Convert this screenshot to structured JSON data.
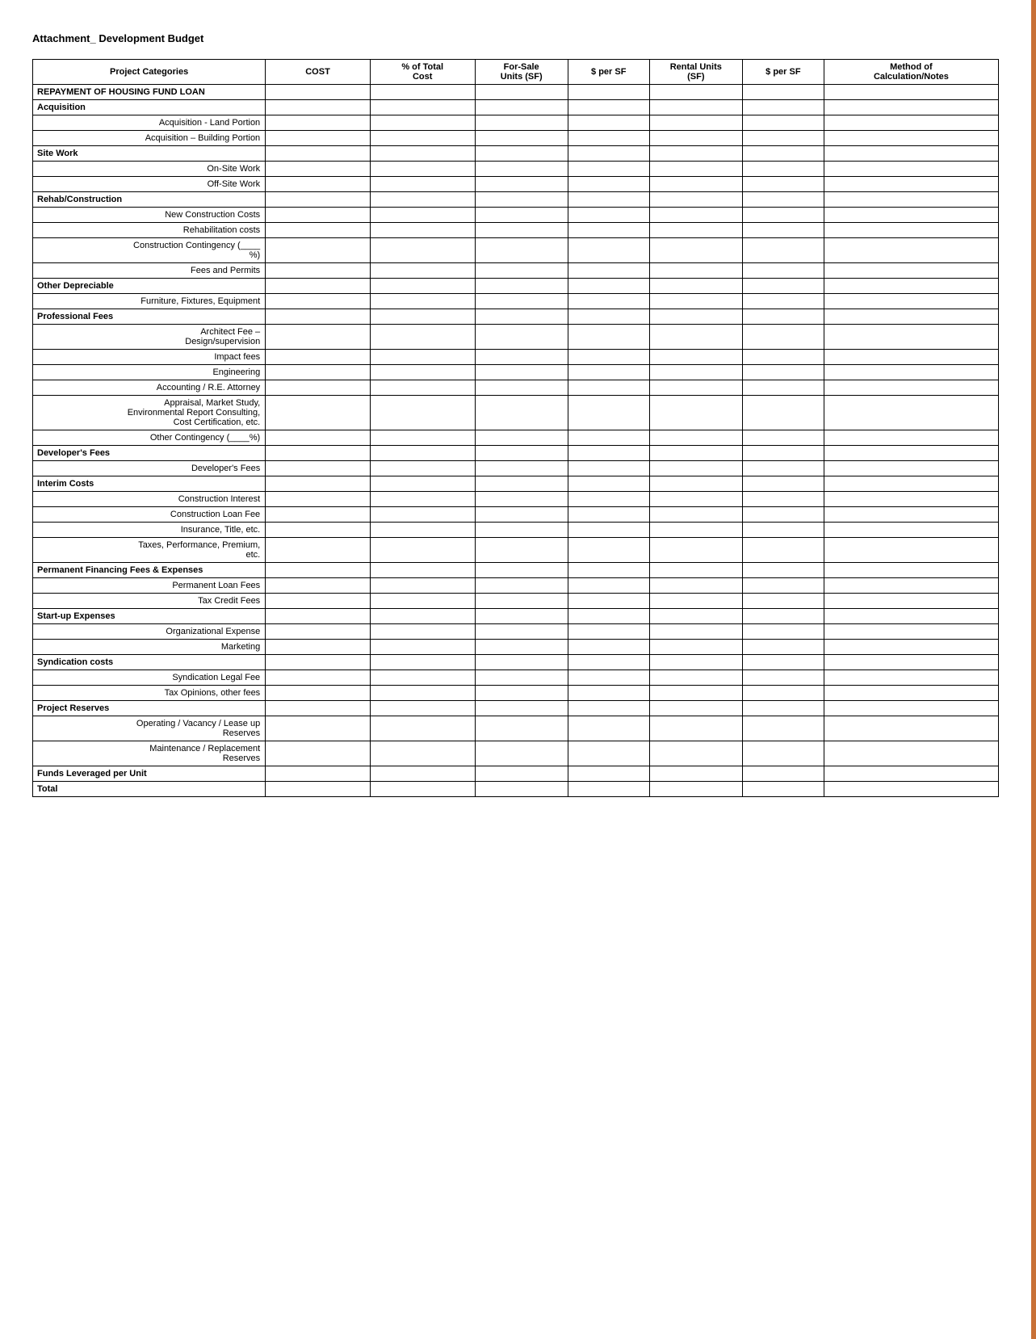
{
  "title": "Attachment_ Development Budget",
  "columns": {
    "project_categories": "Project Categories",
    "cost": "COST",
    "pct_total_cost": "% of Total Cost",
    "for_sale_units": "For-Sale Units (SF)",
    "per_sf_forsale": "$ per SF",
    "rental_units": "Rental Units (SF)",
    "per_sf_rental": "$ per SF",
    "method": "Method of Calculation/Notes"
  },
  "rows": [
    {
      "type": "section",
      "label": "REPAYMENT OF HOUSING FUND LOAN"
    },
    {
      "type": "section",
      "label": "Acquisition"
    },
    {
      "type": "data",
      "label": "Acquisition - Land Portion"
    },
    {
      "type": "data",
      "label": "Acquisition – Building Portion"
    },
    {
      "type": "section",
      "label": "Site Work"
    },
    {
      "type": "data",
      "label": "On-Site Work"
    },
    {
      "type": "data",
      "label": "Off-Site Work"
    },
    {
      "type": "section",
      "label": "Rehab/Construction"
    },
    {
      "type": "data",
      "label": "New Construction Costs"
    },
    {
      "type": "data",
      "label": "Rehabilitation costs"
    },
    {
      "type": "data",
      "label": "Construction Contingency (____\n%)"
    },
    {
      "type": "data",
      "label": "Fees and Permits"
    },
    {
      "type": "section",
      "label": "Other Depreciable"
    },
    {
      "type": "data",
      "label": "Furniture, Fixtures, Equipment"
    },
    {
      "type": "section",
      "label": "Professional Fees"
    },
    {
      "type": "data",
      "label": "Architect Fee –\nDesign/supervision"
    },
    {
      "type": "data",
      "label": "Impact fees"
    },
    {
      "type": "data",
      "label": "Engineering"
    },
    {
      "type": "data",
      "label": "Accounting / R.E. Attorney"
    },
    {
      "type": "data",
      "label": "Appraisal, Market Study,\nEnvironmental Report Consulting,\nCost Certification, etc."
    },
    {
      "type": "data",
      "label": "Other Contingency (____%)",
      "spacer": true
    },
    {
      "type": "section",
      "label": "Developer's Fees"
    },
    {
      "type": "data",
      "label": "Developer's Fees"
    },
    {
      "type": "section",
      "label": "Interim Costs"
    },
    {
      "type": "data",
      "label": "Construction Interest"
    },
    {
      "type": "data",
      "label": "Construction Loan Fee"
    },
    {
      "type": "data",
      "label": "Insurance, Title, etc."
    },
    {
      "type": "data",
      "label": "Taxes, Performance, Premium,\netc."
    },
    {
      "type": "section",
      "label": "Permanent Financing Fees & Expenses"
    },
    {
      "type": "data",
      "label": "Permanent Loan Fees"
    },
    {
      "type": "data",
      "label": "Tax Credit Fees"
    },
    {
      "type": "section",
      "label": "Start-up Expenses"
    },
    {
      "type": "data",
      "label": "Organizational Expense"
    },
    {
      "type": "data",
      "label": "Marketing"
    },
    {
      "type": "section",
      "label": "Syndication costs"
    },
    {
      "type": "data",
      "label": "Syndication Legal Fee"
    },
    {
      "type": "data",
      "label": "Tax Opinions, other fees"
    },
    {
      "type": "section",
      "label": "Project Reserves"
    },
    {
      "type": "data",
      "label": "Operating / Vacancy /  Lease up\nReserves"
    },
    {
      "type": "data",
      "label": "Maintenance / Replacement\nReserves"
    },
    {
      "type": "bold",
      "label": "Funds Leveraged per Unit"
    },
    {
      "type": "bold",
      "label": "Total"
    }
  ]
}
